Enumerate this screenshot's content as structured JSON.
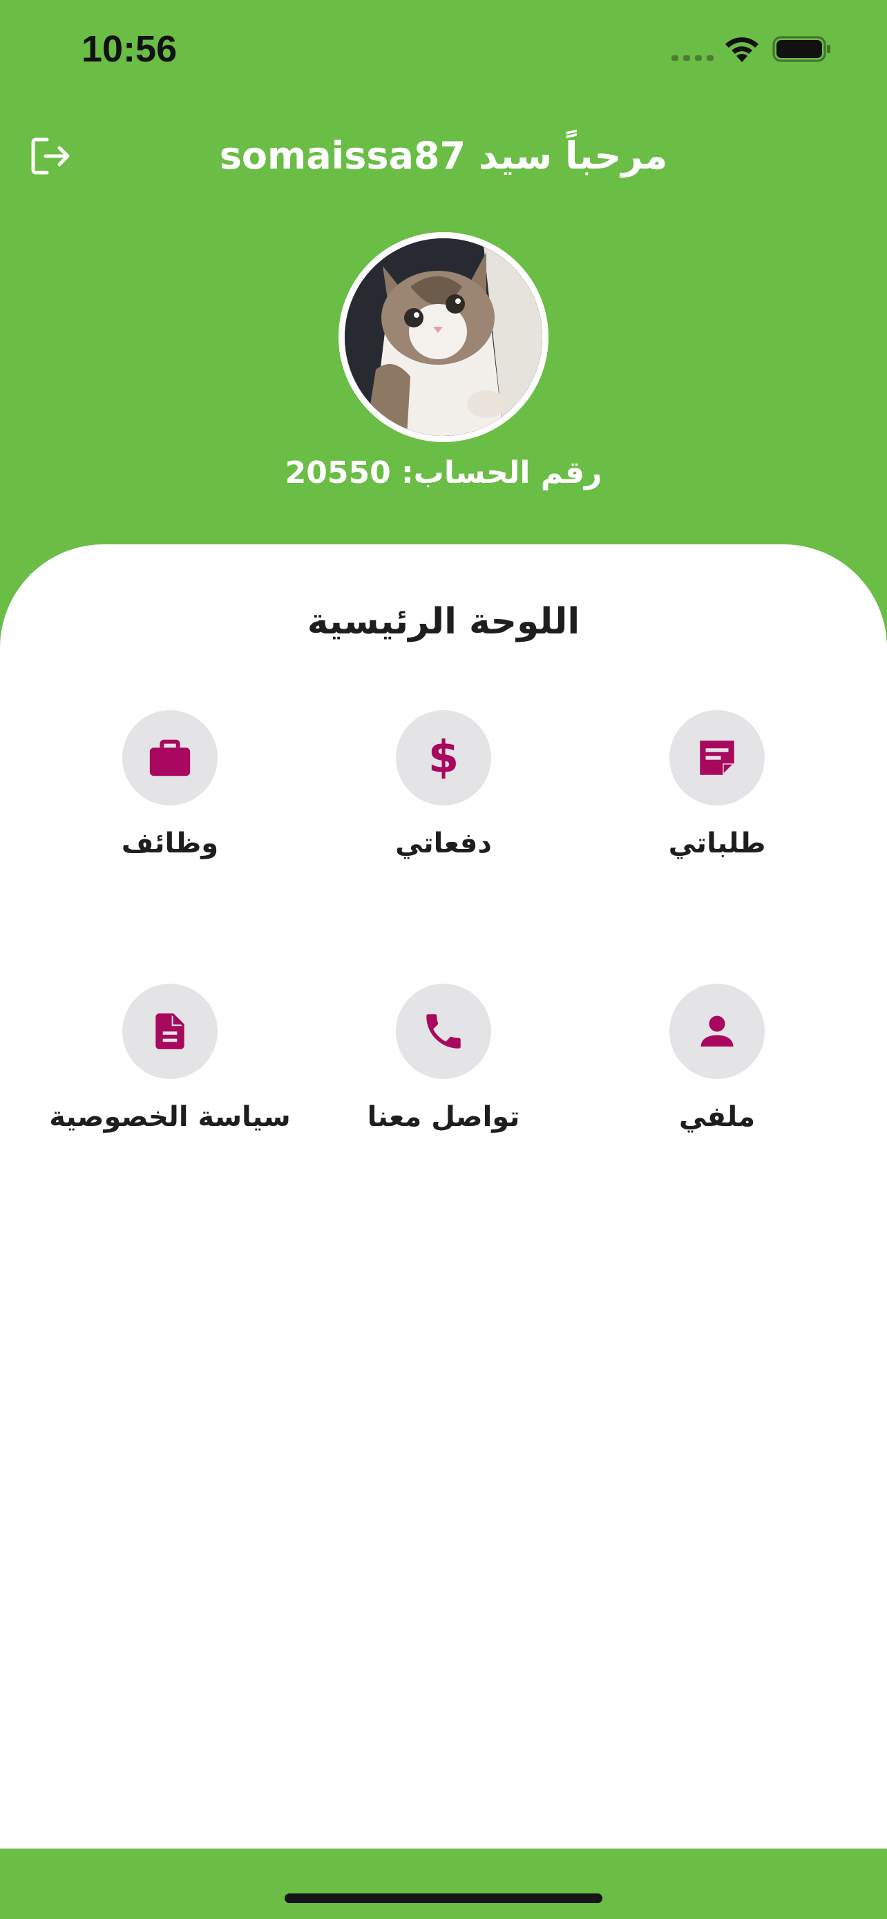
{
  "status_bar": {
    "time": "10:56"
  },
  "header": {
    "welcome": "مرحباً سيد somaissa87",
    "account_number": "رقم الحساب: 20550"
  },
  "dashboard": {
    "title": "اللوحة الرئيسية",
    "tiles": [
      {
        "label": "طلباتي",
        "icon": "order-note-icon"
      },
      {
        "label": "دفعاتي",
        "icon": "dollar-icon"
      },
      {
        "label": "وظائف",
        "icon": "briefcase-icon"
      },
      {
        "label": "ملفي",
        "icon": "person-icon"
      },
      {
        "label": "تواصل معنا",
        "icon": "phone-icon"
      },
      {
        "label": "سياسة الخصوصية",
        "icon": "document-icon"
      }
    ]
  },
  "colors": {
    "brand_green": "#6abd45",
    "icon_magenta": "#a8085e",
    "icon_circle": "#e4e4e6"
  }
}
